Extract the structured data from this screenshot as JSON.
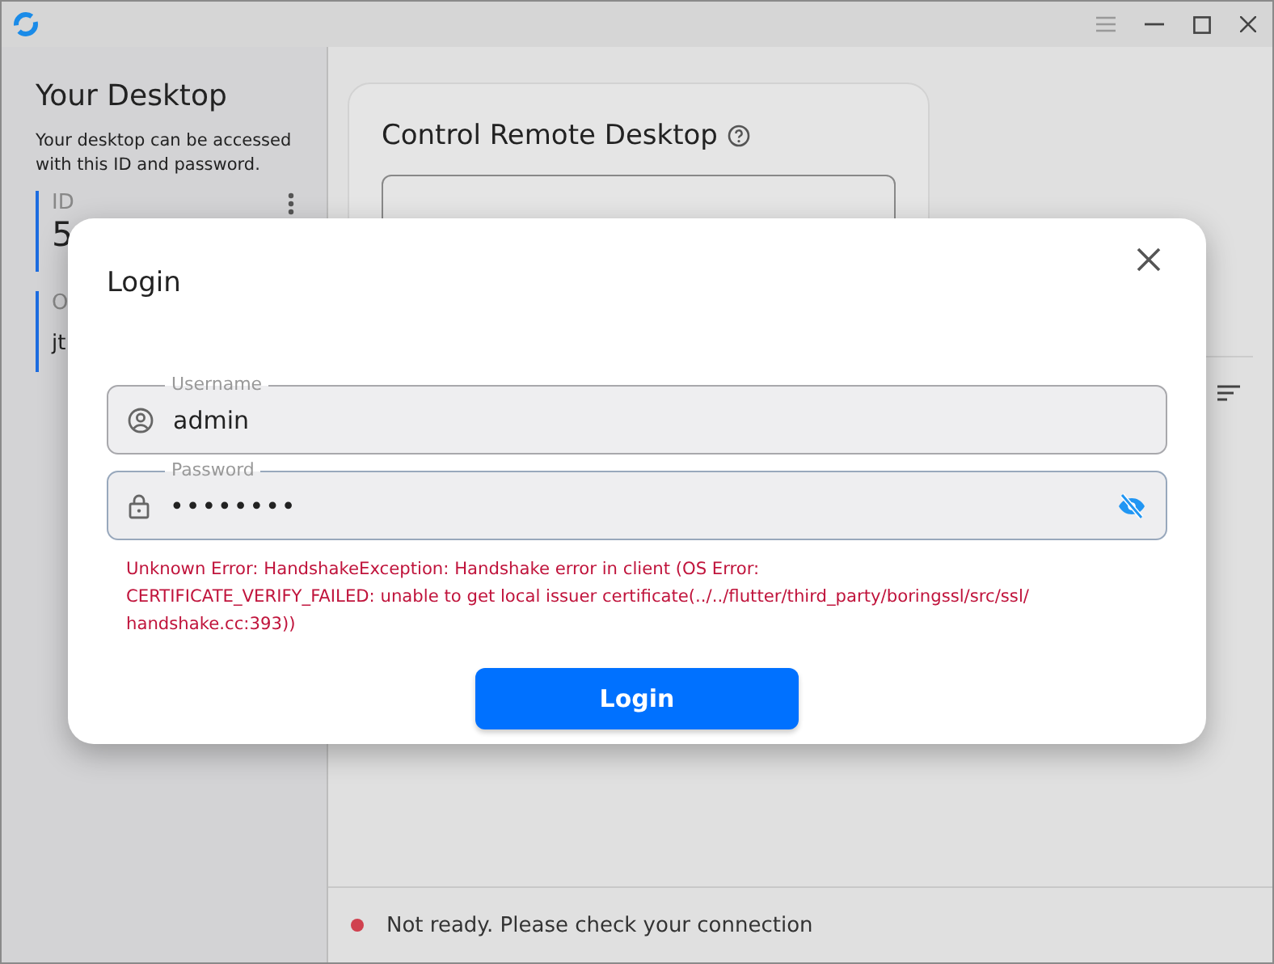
{
  "sidebar": {
    "title": "Your Desktop",
    "description": "Your desktop can be accessed with this ID and password.",
    "id_block": {
      "label": "ID",
      "value": "5"
    },
    "password_block": {
      "label": "O",
      "value": "jt"
    }
  },
  "main": {
    "card_title": "Control Remote Desktop"
  },
  "dialog": {
    "title": "Login",
    "username": {
      "label": "Username",
      "value": "admin"
    },
    "password": {
      "label": "Password",
      "value": "••••••••",
      "hidden": true
    },
    "error": "Unknown Error: HandshakeException: Handshake error in client (OS Error:\n CERTIFICATE_VERIFY_FAILED: unable to get local issuer certificate(../../flutter/third_party/boringssl/src/ssl/\nhandshake.cc:393))",
    "button": "Login"
  },
  "status_bar": {
    "text": "Not ready. Please check your connection"
  }
}
